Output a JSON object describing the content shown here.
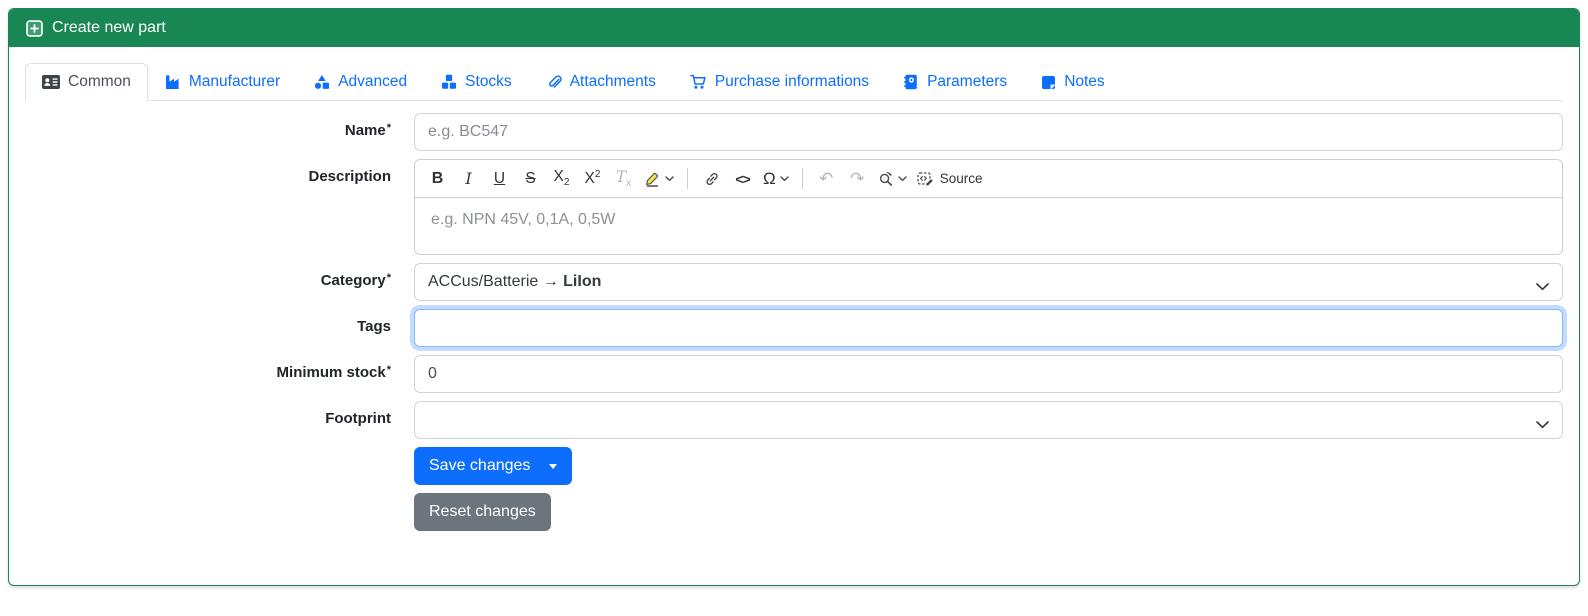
{
  "header": {
    "title": "Create new part"
  },
  "tabs": [
    {
      "label": "Common",
      "icon": "address-card-icon",
      "active": true
    },
    {
      "label": "Manufacturer",
      "icon": "factory-icon",
      "active": false
    },
    {
      "label": "Advanced",
      "icon": "shapes-icon",
      "active": false
    },
    {
      "label": "Stocks",
      "icon": "cubes-icon",
      "active": false
    },
    {
      "label": "Attachments",
      "icon": "paperclip-icon",
      "active": false
    },
    {
      "label": "Purchase informations",
      "icon": "cart-icon",
      "active": false
    },
    {
      "label": "Parameters",
      "icon": "address-book-icon",
      "active": false
    },
    {
      "label": "Notes",
      "icon": "sticky-note-icon",
      "active": false
    }
  ],
  "required_marker": "*",
  "form": {
    "name": {
      "label": "Name",
      "required": true,
      "placeholder": "e.g. BC547",
      "value": ""
    },
    "description": {
      "label": "Description",
      "placeholder": "e.g. NPN 45V, 0,1A, 0,5W",
      "value": "",
      "toolbar": {
        "bold": "B",
        "italic": "I",
        "underline": "U",
        "strikethrough": "S",
        "subscript_base": "X",
        "subscript_mark": "2",
        "superscript_base": "X",
        "superscript_mark": "2",
        "remove_format_base": "T",
        "remove_format_mark": "x",
        "code": "<>",
        "special_char": "Ω",
        "undo": "↶",
        "redo": "↷",
        "source_label": "Source"
      }
    },
    "category": {
      "label": "Category",
      "required": true,
      "value_prefix": "ACCus/Batterie → ",
      "value_bold": "LiIon"
    },
    "tags": {
      "label": "Tags",
      "value": "",
      "focused": true
    },
    "minimum_stock": {
      "label": "Minimum stock",
      "required": true,
      "value": "0"
    },
    "footprint": {
      "label": "Footprint",
      "value": ""
    }
  },
  "actions": {
    "save_label": "Save changes",
    "reset_label": "Reset changes"
  },
  "colors": {
    "header_green": "#198754",
    "link_blue": "#0d6efd",
    "primary_button": "#0d6efd",
    "secondary_button": "#6c757d",
    "active_tab_text": "#495057",
    "tab_border": "#dee2e6",
    "input_border": "#ced4da",
    "placeholder_gray": "#878d93",
    "focus_border": "#86b7fe",
    "focus_ring": "rgba(13,110,253,0.25)",
    "highlighter_yellow": "#fbe34d"
  }
}
